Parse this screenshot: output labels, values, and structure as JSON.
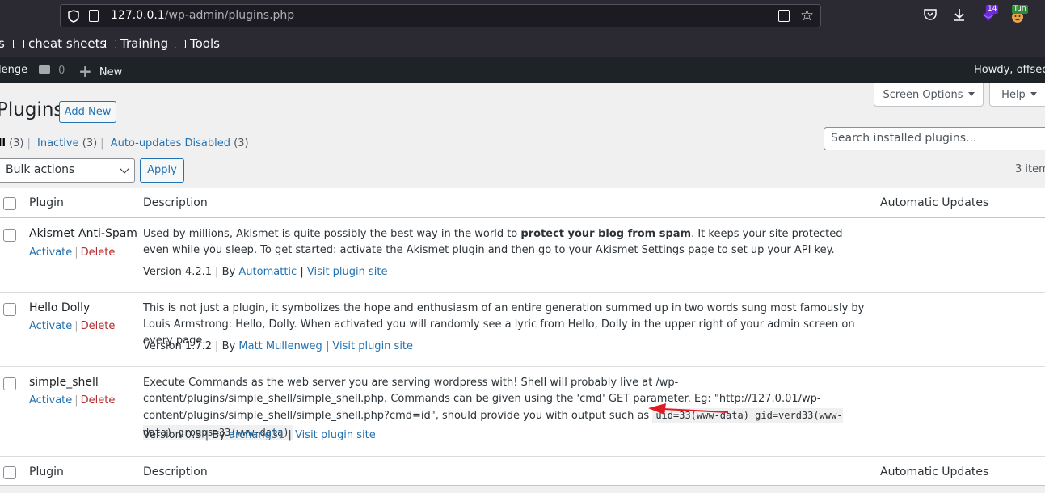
{
  "browser": {
    "url_host": "127.0.0.1",
    "url_path": "/wp-admin/plugins.php",
    "extension_badge_count": "14",
    "profile_badge": "Tun",
    "bookmarks": [
      "s",
      "cheat sheets",
      "Training",
      "Tools"
    ]
  },
  "adminbar": {
    "site_name": "lenge",
    "comments_count": "0",
    "new_label": "New",
    "greeting": "Howdy, offsec"
  },
  "header": {
    "title": "Plugins",
    "add_new": "Add New",
    "screen_options": "Screen Options",
    "help": "Help"
  },
  "search": {
    "placeholder": "Search installed plugins..."
  },
  "filters": {
    "all": "ll",
    "all_count": "(3)",
    "inactive": "Inactive",
    "inactive_count": "(3)",
    "auto_updates_disabled": "Auto-updates Disabled",
    "auto_updates_disabled_count": "(3)"
  },
  "bulk": {
    "selected": "Bulk actions",
    "apply": "Apply",
    "items_count": "3 item"
  },
  "table": {
    "columns": {
      "plugin": "Plugin",
      "description": "Description",
      "auto_updates": "Automatic Updates"
    },
    "actions": {
      "activate": "Activate",
      "delete": "Delete"
    },
    "rows": [
      {
        "name": "Akismet Anti-Spam",
        "desc_pre": "Used by millions, Akismet is quite possibly the best way in the world to ",
        "desc_bold": "protect your blog from spam",
        "desc_post": ". It keeps your site protected even while you sleep. To get started: activate the Akismet plugin and then go to your Akismet Settings page to set up your API key.",
        "version": "Version 4.2.1 | By ",
        "author": "Automattic",
        "visit": "Visit plugin site"
      },
      {
        "name": "Hello Dolly",
        "desc": "This is not just a plugin, it symbolizes the hope and enthusiasm of an entire generation summed up in two words sung most famously by Louis Armstrong: Hello, Dolly. When activated you will randomly see a lyric from Hello, Dolly in the upper right of your admin screen on every page.",
        "version": "Version 1.7.2 | By ",
        "author": "Matt Mullenweg",
        "visit": "Visit plugin site"
      },
      {
        "name": "simple_shell",
        "desc": "Execute Commands as the web server you are serving wordpress with! Shell will probably live at /wp-content/plugins/simple_shell/simple_shell.php. Commands can be given using the 'cmd' GET parameter. Eg: \"http://127.0.01/wp-content/plugins/simple_shell/simple_shell.php?cmd=id\", should provide you with output such as ",
        "code": "uid=33(www-data) gid=verd33(www-data) groups=33(www-data)",
        "version": "Version 0.3 | By ",
        "author": "archang31",
        "visit": "Visit plugin site"
      }
    ]
  },
  "colors": {
    "annotation_arrow": "#e01b24",
    "wp_blue": "#2271b1",
    "delete_red": "#b32d2e"
  }
}
